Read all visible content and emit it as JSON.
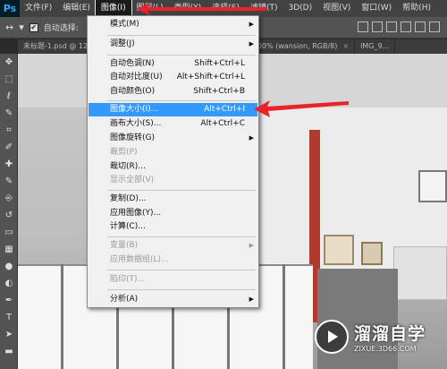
{
  "app": {
    "logo": "Ps"
  },
  "menubar": {
    "items": [
      "文件(F)",
      "编辑(E)",
      "图像(I)",
      "图层(L)",
      "类型(Y)",
      "选择(S)",
      "滤镜(T)",
      "3D(D)",
      "视图(V)",
      "窗口(W)",
      "帮助(H)"
    ],
    "active_index": 2
  },
  "options": {
    "move_glyph": "↔",
    "dropdown_glyph": "▾",
    "auto_select_checked": "✔",
    "auto_select_label": "自动选择:"
  },
  "tabs": [
    {
      "label": "未标题-1.psd @ 12",
      "close": "×"
    },
    {
      "label": "logo.psd @ 100% (wansion, RGB/8)",
      "close": "×"
    },
    {
      "label": "IMG_9...",
      "close": ""
    }
  ],
  "tools": [
    "move-icon",
    "marquee-icon",
    "lasso-icon",
    "quick-select-icon",
    "crop-icon",
    "eyedropper-icon",
    "healing-icon",
    "brush-icon",
    "stamp-icon",
    "history-brush-icon",
    "eraser-icon",
    "gradient-icon",
    "blur-icon",
    "dodge-icon",
    "pen-icon",
    "type-icon",
    "path-select-icon",
    "shape-icon"
  ],
  "tool_glyphs": [
    "✥",
    "⬚",
    "ℓ",
    "✎",
    "⌗",
    "✐",
    "✚",
    "✎",
    "⎆",
    "↺",
    "▭",
    "▦",
    "●",
    "◐",
    "✒",
    "T",
    "➤",
    "▬"
  ],
  "image_menu": {
    "items": [
      {
        "label": "模式(M)",
        "shortcut": "",
        "submenu": true,
        "disabled": false
      },
      {
        "label": "调整(J)",
        "shortcut": "",
        "submenu": true,
        "disabled": false
      },
      {
        "label": "自动色调(N)",
        "shortcut": "Shift+Ctrl+L",
        "submenu": false,
        "disabled": false
      },
      {
        "label": "自动对比度(U)",
        "shortcut": "Alt+Shift+Ctrl+L",
        "submenu": false,
        "disabled": false
      },
      {
        "label": "自动颜色(O)",
        "shortcut": "Shift+Ctrl+B",
        "submenu": false,
        "disabled": false
      },
      {
        "label": "图像大小(I)...",
        "shortcut": "Alt+Ctrl+I",
        "submenu": false,
        "disabled": false,
        "highlight": true
      },
      {
        "label": "画布大小(S)...",
        "shortcut": "Alt+Ctrl+C",
        "submenu": false,
        "disabled": false
      },
      {
        "label": "图像旋转(G)",
        "shortcut": "",
        "submenu": true,
        "disabled": false
      },
      {
        "label": "裁剪(P)",
        "shortcut": "",
        "submenu": false,
        "disabled": true
      },
      {
        "label": "裁切(R)...",
        "shortcut": "",
        "submenu": false,
        "disabled": false
      },
      {
        "label": "显示全部(V)",
        "shortcut": "",
        "submenu": false,
        "disabled": true
      },
      {
        "label": "复制(D)...",
        "shortcut": "",
        "submenu": false,
        "disabled": false
      },
      {
        "label": "应用图像(Y)...",
        "shortcut": "",
        "submenu": false,
        "disabled": false
      },
      {
        "label": "计算(C)...",
        "shortcut": "",
        "submenu": false,
        "disabled": false
      },
      {
        "label": "变量(B)",
        "shortcut": "",
        "submenu": true,
        "disabled": true
      },
      {
        "label": "应用数据组(L)...",
        "shortcut": "",
        "submenu": false,
        "disabled": true
      },
      {
        "label": "陷印(T)...",
        "shortcut": "",
        "submenu": false,
        "disabled": true
      },
      {
        "label": "分析(A)",
        "shortcut": "",
        "submenu": true,
        "disabled": false
      }
    ],
    "submenu_glyph": "▶"
  },
  "watermark": {
    "main": "溜溜自学",
    "sub": "ZIXUE.3D66.COM",
    "logo_glyph": "▶"
  },
  "colors": {
    "menu_highlight": "#3399ff",
    "annotation_red": "#e8232a"
  }
}
